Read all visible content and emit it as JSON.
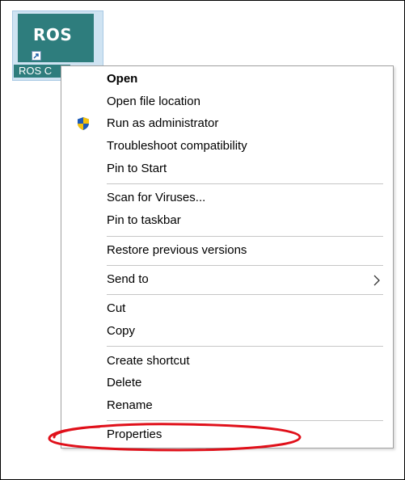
{
  "desktop_shortcut": {
    "tile_text": "ROS",
    "caption": "ROS C"
  },
  "context_menu": {
    "items": {
      "open": "Open",
      "open_file_location": "Open file location",
      "run_as_admin": "Run as administrator",
      "troubleshoot": "Troubleshoot compatibility",
      "pin_to_start": "Pin to Start",
      "scan_viruses": "Scan for Viruses...",
      "pin_to_taskbar": "Pin to taskbar",
      "restore_versions": "Restore previous versions",
      "send_to": "Send to",
      "cut": "Cut",
      "copy": "Copy",
      "create_shortcut": "Create shortcut",
      "delete": "Delete",
      "rename": "Rename",
      "properties": "Properties"
    }
  },
  "icons": {
    "admin": "uac-shield-icon",
    "submenu": "chevron-right-icon",
    "shortcut": "shortcut-arrow-icon"
  },
  "colors": {
    "icon_tile": "#2e7d7d",
    "selection_background": "#cfe3f2",
    "highlight_oval": "#e0101a",
    "separator": "#c6c6c6"
  }
}
